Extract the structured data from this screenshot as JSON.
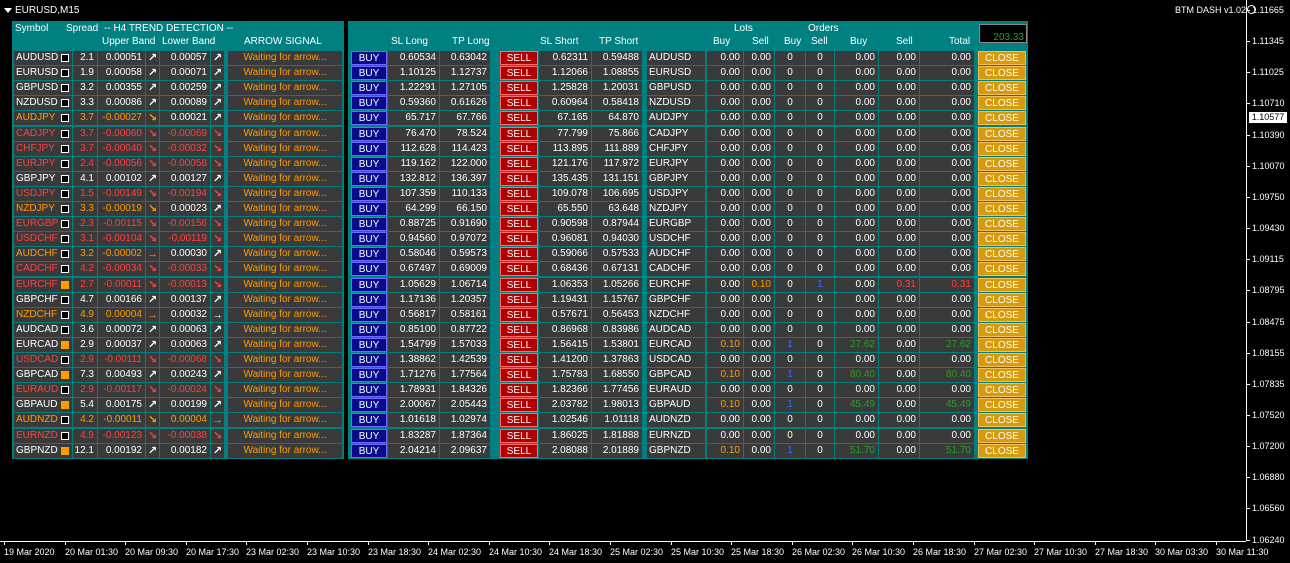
{
  "window": {
    "title": "EURUSD,M15",
    "brand": "BTM DASH v1.02"
  },
  "price_axis": {
    "labels": [
      "1.11665",
      "1.11345",
      "1.11025",
      "1.10710",
      "1.10390",
      "1.10070",
      "1.09750",
      "1.09430",
      "1.09115",
      "1.08795",
      "1.08475",
      "1.08155",
      "1.07835",
      "1.07520",
      "1.07200",
      "1.06880",
      "1.06560",
      "1.06240"
    ],
    "current": "1.10577"
  },
  "time_axis": [
    "19 Mar 2020",
    "20 Mar 01:30",
    "20 Mar 09:30",
    "20 Mar 17:30",
    "23 Mar 02:30",
    "23 Mar 10:30",
    "23 Mar 18:30",
    "24 Mar 02:30",
    "24 Mar 10:30",
    "24 Mar 18:30",
    "25 Mar 02:30",
    "25 Mar 10:30",
    "25 Mar 18:30",
    "26 Mar 02:30",
    "26 Mar 10:30",
    "26 Mar 18:30",
    "27 Mar 02:30",
    "27 Mar 10:30",
    "27 Mar 18:30",
    "30 Mar 03:30",
    "30 Mar 11:30"
  ],
  "headers": {
    "symbol": "Symbol",
    "spread": "Spread",
    "trend": "-- H4  TREND DETECTION --",
    "upper": "Upper Band",
    "lower": "Lower Band",
    "arrow": "ARROW SIGNAL",
    "sl_long": "SL Long",
    "tp_long": "TP Long",
    "sl_short": "SL Short",
    "tp_short": "TP Short",
    "lots": "Lots",
    "orders": "Orders",
    "buy": "Buy",
    "sell": "Sell",
    "total": "Total",
    "buy_total": "Buy",
    "sell_total": "Sell"
  },
  "labels": {
    "buy_btn": "BUY",
    "sell_btn": "SELL",
    "close_btn": "CLOSE",
    "signal": "Waiting for arrow..."
  },
  "total_pl": "203.33",
  "colors": {
    "green": "#2a9d2a",
    "orange": "#ff9c00",
    "red": "#ff4040",
    "blue": "#3a6aff",
    "panel": "#008080"
  },
  "rows": [
    {
      "sym": "AUDUSD",
      "col": "white",
      "box": "white",
      "spread": "2.1",
      "upper": "0.00051",
      "ucol": "white",
      "uarrow": "up",
      "lower": "0.00057",
      "lcol": "white",
      "larrow": "up",
      "sl_long": "0.60534",
      "tp_long": "0.63042",
      "sl_short": "0.62311",
      "tp_short": "0.59488",
      "lb": "0.00",
      "ls": "0.00",
      "ob": "0",
      "os": "0",
      "pb": "0.00",
      "ps": "0.00",
      "tot": "0.00"
    },
    {
      "sym": "EURUSD",
      "col": "white",
      "box": "white",
      "spread": "1.9",
      "upper": "0.00058",
      "ucol": "white",
      "uarrow": "up",
      "lower": "0.00071",
      "lcol": "white",
      "larrow": "up",
      "sl_long": "1.10125",
      "tp_long": "1.12737",
      "sl_short": "1.12066",
      "tp_short": "1.08855",
      "lb": "0.00",
      "ls": "0.00",
      "ob": "0",
      "os": "0",
      "pb": "0.00",
      "ps": "0.00",
      "tot": "0.00"
    },
    {
      "sym": "GBPUSD",
      "col": "white",
      "box": "white",
      "spread": "3.2",
      "upper": "0.00355",
      "ucol": "white",
      "uarrow": "up",
      "lower": "0.00259",
      "lcol": "white",
      "larrow": "up",
      "sl_long": "1.22291",
      "tp_long": "1.27105",
      "sl_short": "1.25828",
      "tp_short": "1.20031",
      "lb": "0.00",
      "ls": "0.00",
      "ob": "0",
      "os": "0",
      "pb": "0.00",
      "ps": "0.00",
      "tot": "0.00"
    },
    {
      "sym": "NZDUSD",
      "col": "white",
      "box": "white",
      "spread": "3.3",
      "upper": "0.00086",
      "ucol": "white",
      "uarrow": "up",
      "lower": "0.00089",
      "lcol": "white",
      "larrow": "up",
      "sl_long": "0.59360",
      "tp_long": "0.61626",
      "sl_short": "0.60964",
      "tp_short": "0.58418",
      "lb": "0.00",
      "ls": "0.00",
      "ob": "0",
      "os": "0",
      "pb": "0.00",
      "ps": "0.00",
      "tot": "0.00"
    },
    {
      "sym": "AUDJPY",
      "col": "orange",
      "box": "white",
      "spread": "3.7",
      "upper": "-0.00027",
      "ucol": "orange",
      "uarrow": "down",
      "lower": "0.00021",
      "lcol": "white",
      "larrow": "up",
      "sl_long": "65.717",
      "tp_long": "67.766",
      "sl_short": "67.165",
      "tp_short": "64.870",
      "lb": "0.00",
      "ls": "0.00",
      "ob": "0",
      "os": "0",
      "pb": "0.00",
      "ps": "0.00",
      "tot": "0.00"
    },
    {
      "sym": "CADJPY",
      "col": "red",
      "box": "white",
      "spread": "3.7",
      "upper": "-0.00060",
      "ucol": "red",
      "uarrow": "down",
      "lower": "-0.00069",
      "lcol": "red",
      "larrow": "down",
      "sl_long": "76.470",
      "tp_long": "78.524",
      "sl_short": "77.799",
      "tp_short": "75.866",
      "lb": "0.00",
      "ls": "0.00",
      "ob": "0",
      "os": "0",
      "pb": "0.00",
      "ps": "0.00",
      "tot": "0.00"
    },
    {
      "sym": "CHFJPY",
      "col": "red",
      "box": "white",
      "spread": "3.7",
      "upper": "-0.00040",
      "ucol": "red",
      "uarrow": "down",
      "lower": "-0.00032",
      "lcol": "red",
      "larrow": "down",
      "sl_long": "112.628",
      "tp_long": "114.423",
      "sl_short": "113.895",
      "tp_short": "111.889",
      "lb": "0.00",
      "ls": "0.00",
      "ob": "0",
      "os": "0",
      "pb": "0.00",
      "ps": "0.00",
      "tot": "0.00"
    },
    {
      "sym": "EURJPY",
      "col": "red",
      "box": "white",
      "spread": "2.4",
      "upper": "-0.00056",
      "ucol": "red",
      "uarrow": "down",
      "lower": "-0.00058",
      "lcol": "red",
      "larrow": "down",
      "sl_long": "119.162",
      "tp_long": "122.000",
      "sl_short": "121.176",
      "tp_short": "117.972",
      "lb": "0.00",
      "ls": "0.00",
      "ob": "0",
      "os": "0",
      "pb": "0.00",
      "ps": "0.00",
      "tot": "0.00"
    },
    {
      "sym": "GBPJPY",
      "col": "white",
      "box": "white",
      "spread": "4.1",
      "upper": "0.00102",
      "ucol": "white",
      "uarrow": "up",
      "lower": "0.00127",
      "lcol": "white",
      "larrow": "up",
      "sl_long": "132.812",
      "tp_long": "136.397",
      "sl_short": "135.435",
      "tp_short": "131.151",
      "lb": "0.00",
      "ls": "0.00",
      "ob": "0",
      "os": "0",
      "pb": "0.00",
      "ps": "0.00",
      "tot": "0.00"
    },
    {
      "sym": "USDJPY",
      "col": "red",
      "box": "white",
      "spread": "1.5",
      "upper": "-0.00149",
      "ucol": "red",
      "uarrow": "down",
      "lower": "-0.00194",
      "lcol": "red",
      "larrow": "down",
      "sl_long": "107.359",
      "tp_long": "110.133",
      "sl_short": "109.078",
      "tp_short": "106.695",
      "lb": "0.00",
      "ls": "0.00",
      "ob": "0",
      "os": "0",
      "pb": "0.00",
      "ps": "0.00",
      "tot": "0.00"
    },
    {
      "sym": "NZDJPY",
      "col": "orange",
      "box": "white",
      "spread": "3.3",
      "upper": "-0.00019",
      "ucol": "orange",
      "uarrow": "down",
      "lower": "0.00023",
      "lcol": "white",
      "larrow": "up",
      "sl_long": "64.299",
      "tp_long": "66.150",
      "sl_short": "65.550",
      "tp_short": "63.648",
      "lb": "0.00",
      "ls": "0.00",
      "ob": "0",
      "os": "0",
      "pb": "0.00",
      "ps": "0.00",
      "tot": "0.00"
    },
    {
      "sym": "EURGBP",
      "col": "red",
      "box": "white",
      "spread": "2.3",
      "upper": "-0.00115",
      "ucol": "red",
      "uarrow": "down",
      "lower": "-0.00156",
      "lcol": "red",
      "larrow": "down",
      "sl_long": "0.88725",
      "tp_long": "0.91690",
      "sl_short": "0.90598",
      "tp_short": "0.87944",
      "lb": "0.00",
      "ls": "0.00",
      "ob": "0",
      "os": "0",
      "pb": "0.00",
      "ps": "0.00",
      "tot": "0.00"
    },
    {
      "sym": "USDCHF",
      "col": "red",
      "box": "white",
      "spread": "3.1",
      "upper": "-0.00104",
      "ucol": "red",
      "uarrow": "down",
      "lower": "-0.00119",
      "lcol": "red",
      "larrow": "down",
      "sl_long": "0.94560",
      "tp_long": "0.97072",
      "sl_short": "0.96081",
      "tp_short": "0.94030",
      "lb": "0.00",
      "ls": "0.00",
      "ob": "0",
      "os": "0",
      "pb": "0.00",
      "ps": "0.00",
      "tot": "0.00"
    },
    {
      "sym": "AUDCHF",
      "col": "orange",
      "box": "white",
      "spread": "3.2",
      "upper": "-0.00002",
      "ucol": "orange",
      "uarrow": "right",
      "lower": "0.00030",
      "lcol": "white",
      "larrow": "up",
      "sl_long": "0.58046",
      "tp_long": "0.59573",
      "sl_short": "0.59066",
      "tp_short": "0.57533",
      "lb": "0.00",
      "ls": "0.00",
      "ob": "0",
      "os": "0",
      "pb": "0.00",
      "ps": "0.00",
      "tot": "0.00"
    },
    {
      "sym": "CADCHF",
      "col": "red",
      "box": "white",
      "spread": "4.2",
      "upper": "-0.00034",
      "ucol": "red",
      "uarrow": "down",
      "lower": "-0.00033",
      "lcol": "red",
      "larrow": "down",
      "sl_long": "0.67497",
      "tp_long": "0.69009",
      "sl_short": "0.68436",
      "tp_short": "0.67131",
      "lb": "0.00",
      "ls": "0.00",
      "ob": "0",
      "os": "0",
      "pb": "0.00",
      "ps": "0.00",
      "tot": "0.00"
    },
    {
      "sym": "EURCHF",
      "col": "red",
      "box": "orange",
      "spread": "2.7",
      "upper": "-0.00011",
      "ucol": "red",
      "uarrow": "down",
      "lower": "-0.00013",
      "lcol": "red",
      "larrow": "down",
      "sl_long": "1.05629",
      "tp_long": "1.06714",
      "sl_short": "1.06353",
      "tp_short": "1.05266",
      "lb": "0.00",
      "ls": "0.10",
      "ob": "0",
      "os": "1",
      "pb": "0.00",
      "ps": "0.31",
      "tot": "0.31",
      "lscol": "orange",
      "oscol": "blue",
      "pscol": "red",
      "totcol": "red"
    },
    {
      "sym": "GBPCHF",
      "col": "white",
      "box": "white",
      "spread": "4.7",
      "upper": "0.00166",
      "ucol": "white",
      "uarrow": "up",
      "lower": "0.00137",
      "lcol": "white",
      "larrow": "up",
      "sl_long": "1.17136",
      "tp_long": "1.20357",
      "sl_short": "1.19431",
      "tp_short": "1.15767",
      "lb": "0.00",
      "ls": "0.00",
      "ob": "0",
      "os": "0",
      "pb": "0.00",
      "ps": "0.00",
      "tot": "0.00"
    },
    {
      "sym": "NZDCHF",
      "col": "orange",
      "box": "white",
      "spread": "4.9",
      "upper": "0.00004",
      "ucol": "orange",
      "uarrow": "right",
      "lower": "0.00032",
      "lcol": "white",
      "larrow": "right",
      "sl_long": "0.56817",
      "tp_long": "0.58161",
      "sl_short": "0.57671",
      "tp_short": "0.56453",
      "lb": "0.00",
      "ls": "0.00",
      "ob": "0",
      "os": "0",
      "pb": "0.00",
      "ps": "0.00",
      "tot": "0.00"
    },
    {
      "sym": "AUDCAD",
      "col": "white",
      "box": "white",
      "spread": "3.6",
      "upper": "0.00072",
      "ucol": "white",
      "uarrow": "up",
      "lower": "0.00063",
      "lcol": "white",
      "larrow": "up",
      "sl_long": "0.85100",
      "tp_long": "0.87722",
      "sl_short": "0.86968",
      "tp_short": "0.83986",
      "lb": "0.00",
      "ls": "0.00",
      "ob": "0",
      "os": "0",
      "pb": "0.00",
      "ps": "0.00",
      "tot": "0.00"
    },
    {
      "sym": "EURCAD",
      "col": "white",
      "box": "orange",
      "spread": "2.9",
      "upper": "0.00037",
      "ucol": "white",
      "uarrow": "up",
      "lower": "0.00063",
      "lcol": "white",
      "larrow": "up",
      "sl_long": "1.54799",
      "tp_long": "1.57033",
      "sl_short": "1.56415",
      "tp_short": "1.53801",
      "lb": "0.10",
      "ls": "0.00",
      "ob": "1",
      "os": "0",
      "pb": "27.62",
      "ps": "0.00",
      "tot": "27.62",
      "lbcol": "orange",
      "obcol": "blue",
      "pbcol": "green",
      "totcol": "green"
    },
    {
      "sym": "USDCAD",
      "col": "red",
      "box": "white",
      "spread": "2.9",
      "upper": "-0.00111",
      "ucol": "red",
      "uarrow": "down",
      "lower": "-0.00068",
      "lcol": "red",
      "larrow": "down",
      "sl_long": "1.38862",
      "tp_long": "1.42539",
      "sl_short": "1.41200",
      "tp_short": "1.37863",
      "lb": "0.00",
      "ls": "0.00",
      "ob": "0",
      "os": "0",
      "pb": "0.00",
      "ps": "0.00",
      "tot": "0.00"
    },
    {
      "sym": "GBPCAD",
      "col": "white",
      "box": "orange",
      "spread": "7.3",
      "upper": "0.00493",
      "ucol": "white",
      "uarrow": "up",
      "lower": "0.00243",
      "lcol": "white",
      "larrow": "up",
      "sl_long": "1.71276",
      "tp_long": "1.77564",
      "sl_short": "1.75783",
      "tp_short": "1.68550",
      "lb": "0.10",
      "ls": "0.00",
      "ob": "1",
      "os": "0",
      "pb": "80.40",
      "ps": "0.00",
      "tot": "80.40",
      "lbcol": "orange",
      "obcol": "blue",
      "pbcol": "green",
      "totcol": "green"
    },
    {
      "sym": "EURAUD",
      "col": "red",
      "box": "white",
      "spread": "2.9",
      "upper": "-0.00117",
      "ucol": "red",
      "uarrow": "down",
      "lower": "-0.00024",
      "lcol": "red",
      "larrow": "down",
      "sl_long": "1.78931",
      "tp_long": "1.84326",
      "sl_short": "1.82366",
      "tp_short": "1.77456",
      "lb": "0.00",
      "ls": "0.00",
      "ob": "0",
      "os": "0",
      "pb": "0.00",
      "ps": "0.00",
      "tot": "0.00"
    },
    {
      "sym": "GBPAUD",
      "col": "white",
      "box": "orange",
      "spread": "5.4",
      "upper": "0.00175",
      "ucol": "white",
      "uarrow": "up",
      "lower": "0.00199",
      "lcol": "white",
      "larrow": "up",
      "sl_long": "2.00067",
      "tp_long": "2.05443",
      "sl_short": "2.03782",
      "tp_short": "1.98013",
      "lb": "0.10",
      "ls": "0.00",
      "ob": "1",
      "os": "0",
      "pb": "45.49",
      "ps": "0.00",
      "tot": "45.49",
      "lbcol": "orange",
      "obcol": "blue",
      "pbcol": "green",
      "totcol": "green"
    },
    {
      "sym": "AUDNZD",
      "col": "orange",
      "box": "white",
      "spread": "4.2",
      "upper": "-0.00011",
      "ucol": "orange",
      "uarrow": "down",
      "lower": "0.00004",
      "lcol": "orange",
      "larrow": "right",
      "sl_long": "1.01618",
      "tp_long": "1.02974",
      "sl_short": "1.02546",
      "tp_short": "1.01118",
      "lb": "0.00",
      "ls": "0.00",
      "ob": "0",
      "os": "0",
      "pb": "0.00",
      "ps": "0.00",
      "tot": "0.00"
    },
    {
      "sym": "EURNZD",
      "col": "red",
      "box": "white",
      "spread": "4.9",
      "upper": "-0.00123",
      "ucol": "red",
      "uarrow": "down",
      "lower": "-0.00038",
      "lcol": "red",
      "larrow": "down",
      "sl_long": "1.83287",
      "tp_long": "1.87364",
      "sl_short": "1.86025",
      "tp_short": "1.81888",
      "lb": "0.00",
      "ls": "0.00",
      "ob": "0",
      "os": "0",
      "pb": "0.00",
      "ps": "0.00",
      "tot": "0.00"
    },
    {
      "sym": "GBPNZD",
      "col": "white",
      "box": "orange",
      "spread": "12.1",
      "upper": "0.00192",
      "ucol": "white",
      "uarrow": "up",
      "lower": "0.00182",
      "lcol": "white",
      "larrow": "up",
      "sl_long": "2.04214",
      "tp_long": "2.09637",
      "sl_short": "2.08088",
      "tp_short": "2.01889",
      "lb": "0.10",
      "ls": "0.00",
      "ob": "1",
      "os": "0",
      "pb": "51.70",
      "ps": "0.00",
      "tot": "51.70",
      "lbcol": "orange",
      "obcol": "blue",
      "pbcol": "green",
      "totcol": "green"
    }
  ]
}
